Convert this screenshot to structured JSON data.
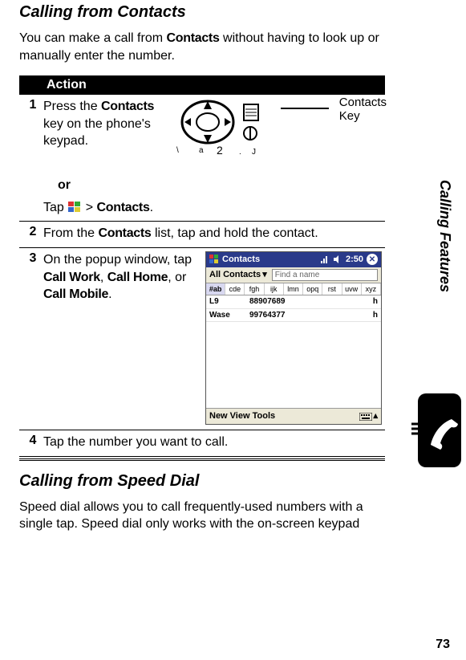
{
  "page_number": "73",
  "side_label": "Calling Features",
  "section1": {
    "title": "Calling from Contacts",
    "intro_pre": "You can make a call from ",
    "intro_bold": "Contacts",
    "intro_post": " without having to look up or manually enter the number."
  },
  "action_header": "Action",
  "steps": {
    "s1": {
      "num": "1",
      "text_pre": "Press the ",
      "text_bold": "Contacts",
      "text_post": " key on the phone's keypad.",
      "or": "or",
      "tap_pre": "Tap ",
      "tap_mid": " > ",
      "tap_bold": "Contacts",
      "callout_l1": "Contacts",
      "callout_l2": "Key"
    },
    "s2": {
      "num": "2",
      "pre": "From the ",
      "bold": "Contacts",
      "post": " list, tap and hold the contact."
    },
    "s3": {
      "num": "3",
      "pre": "On the popup window, tap ",
      "b1": "Call Work",
      "mid1": ", ",
      "b2": "Call Home",
      "mid2": ", or ",
      "b3": "Call Mobile",
      "post": "."
    },
    "s4": {
      "num": "4",
      "text": "Tap the number you want to call."
    }
  },
  "screenshot": {
    "title": "Contacts",
    "time": "2:50",
    "filter": "All Contacts",
    "search_placeholder": "Find a name",
    "alpha": [
      "#ab",
      "cde",
      "fgh",
      "ijk",
      "lmn",
      "opq",
      "rst",
      "uvw",
      "xyz"
    ],
    "rows": [
      {
        "name": "L9",
        "num": "88907689",
        "tag": "h"
      },
      {
        "name": "Wase",
        "num": "99764377",
        "tag": "h"
      }
    ],
    "bottom": "New  View  Tools"
  },
  "section2": {
    "title": "Calling from Speed Dial",
    "body": "Speed dial allows you to call frequently-used numbers with a single tap. Speed dial only works with the on-screen keypad"
  }
}
